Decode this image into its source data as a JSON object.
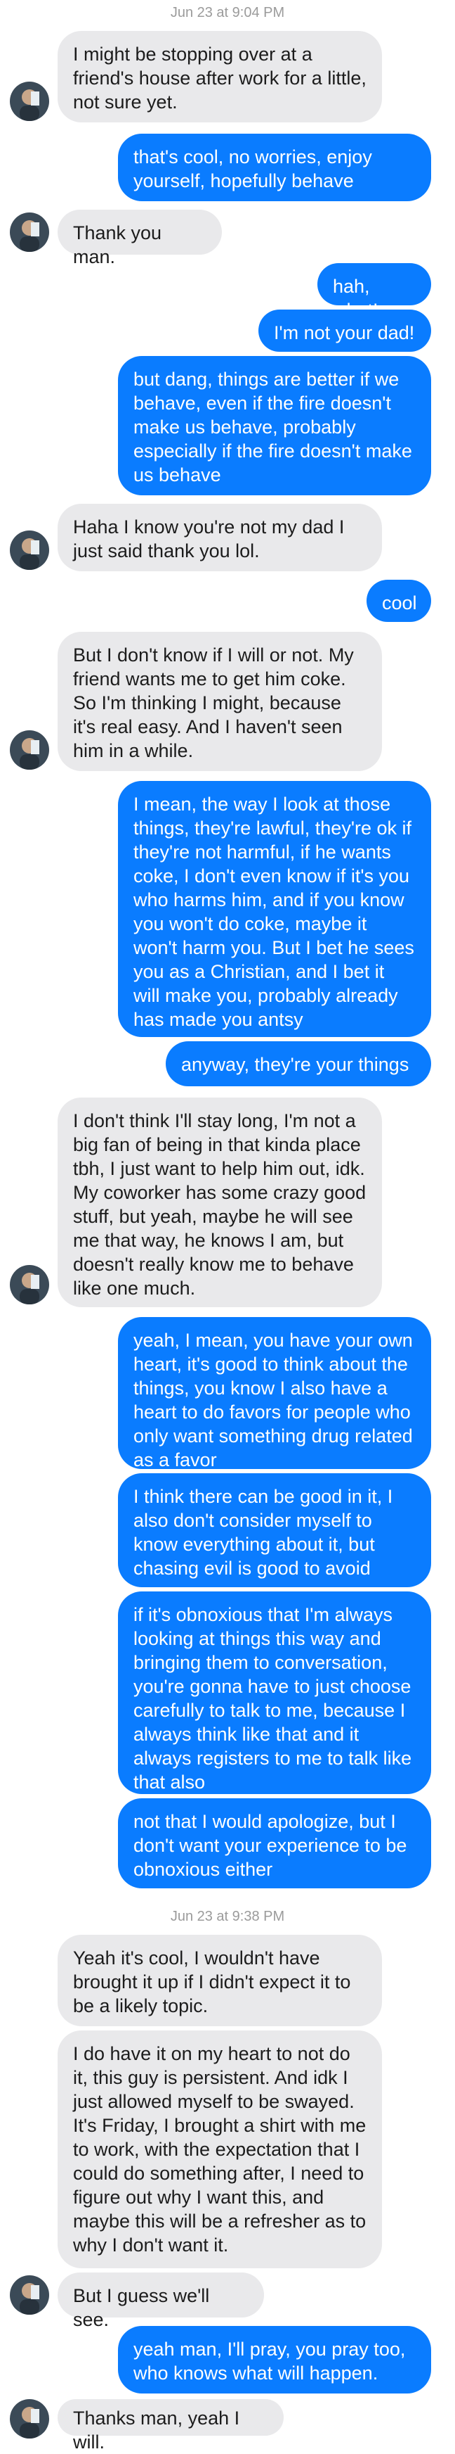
{
  "thread": {
    "timestamps": [
      "Jun 23 at 9:04 PM",
      "Jun 23 at 9:38 PM"
    ],
    "messages": [
      {
        "dir": "in",
        "text": "I might be stopping over at a friend's house after work for a little, not sure yet."
      },
      {
        "dir": "out",
        "text": "that's cool, no worries, enjoy yourself, hopefully behave"
      },
      {
        "dir": "in",
        "text": "Thank you man."
      },
      {
        "dir": "out",
        "text": "hah, what!"
      },
      {
        "dir": "out",
        "text": "I'm not your dad!"
      },
      {
        "dir": "out",
        "text": "but dang, things are better if we behave, even if the fire doesn't make us behave, probably especially if the fire doesn't make us behave"
      },
      {
        "dir": "in",
        "text": "Haha I know you're not my dad I just said thank you lol."
      },
      {
        "dir": "out",
        "text": "cool"
      },
      {
        "dir": "in",
        "text": "But I don't know if I will or not. My friend wants me to get him coke. So I'm thinking I might, because it's real easy. And I haven't seen him in a while."
      },
      {
        "dir": "out",
        "text": "I mean, the way I look at those things, they're lawful, they're ok if they're not harmful, if he wants coke, I don't even know if it's you who harms him, and if you know you won't do coke, maybe it won't harm you. But I bet he sees you as a Christian, and I bet it will make you, probably already has made you antsy"
      },
      {
        "dir": "out",
        "text": "anyway, they're your things"
      },
      {
        "dir": "in",
        "text": "I don't think I'll stay long, I'm not a big fan of being in that kinda place tbh, I just want to help him out, idk. My coworker has some crazy good stuff, but yeah, maybe he will see me that way, he knows I am, but doesn't really know me to behave like one much."
      },
      {
        "dir": "out",
        "text": "yeah, I mean, you have your own heart, it's good to think about the things, you know I also have a heart to do favors for people who only want something drug related as a favor"
      },
      {
        "dir": "out",
        "text": "I think there can be good in it, I also don't consider myself to know everything about it, but chasing evil is good to avoid"
      },
      {
        "dir": "out",
        "text": "if it's obnoxious that I'm always looking at things this way and bringing them to conversation, you're gonna have to just choose carefully to talk to me, because I always think like that and it always registers to me to talk like that also"
      },
      {
        "dir": "out",
        "text": "not that I would apologize, but I don't want your experience to be obnoxious either"
      },
      {
        "dir": "in",
        "text": "Yeah it's cool, I wouldn't have brought it up if I didn't expect it to be a likely topic."
      },
      {
        "dir": "in",
        "text": "I do have it on my heart to not do it, this guy is persistent. And idk I just allowed myself to be swayed. It's Friday, I brought a shirt with me to work, with the expectation that I could do something after, I need to figure out why I want this, and maybe this will be a refresher as to why I don't want it."
      },
      {
        "dir": "in",
        "text": "But I guess we'll see."
      },
      {
        "dir": "out",
        "text": "yeah man, I'll pray, you pray too, who knows what will happen."
      },
      {
        "dir": "in",
        "text": "Thanks man, yeah I will."
      }
    ]
  },
  "colors": {
    "outgoing": "#0a7cff",
    "incoming": "#e9e9eb",
    "timestamp": "#9b9b9b"
  },
  "icons": {
    "avatar": "contact-avatar-photo"
  }
}
